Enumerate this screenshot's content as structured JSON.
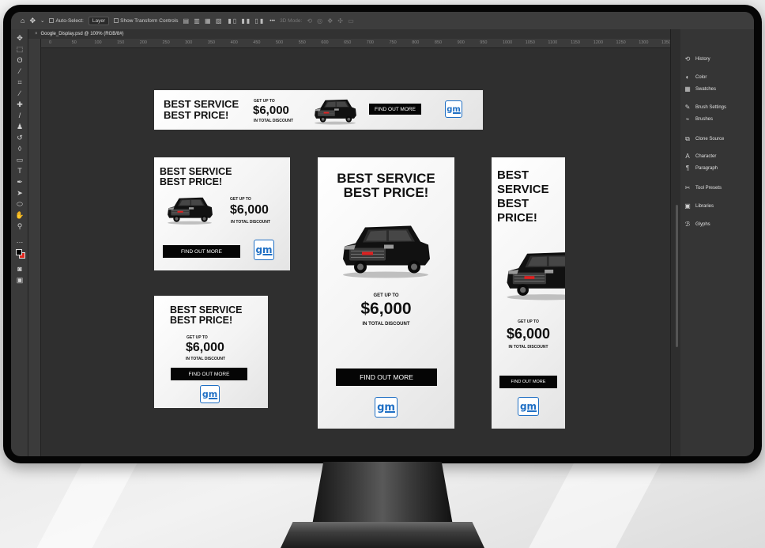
{
  "optionsbar": {
    "autoselect_label": "Auto-Select:",
    "autoselect_value": "Layer",
    "transform_label": "Show Transform Controls",
    "mode_label": "3D Mode:"
  },
  "document": {
    "tab_title": "Google_Display.psd @ 100% (RGB/8#)"
  },
  "ruler": [
    "0",
    "50",
    "100",
    "150",
    "200",
    "250",
    "300",
    "350",
    "400",
    "450",
    "500",
    "550",
    "600",
    "650",
    "700",
    "750",
    "800",
    "850",
    "900",
    "950",
    "1000",
    "1050",
    "1100",
    "1150",
    "1200",
    "1250",
    "1300",
    "1350"
  ],
  "panels": {
    "items": [
      {
        "label": "History",
        "icon": "history-icon"
      },
      {
        "label": "Color",
        "icon": "color-icon"
      },
      {
        "label": "Swatches",
        "icon": "swatches-icon"
      },
      {
        "label": "Brush Settings",
        "icon": "brush-settings-icon"
      },
      {
        "label": "Brushes",
        "icon": "brushes-icon"
      },
      {
        "label": "Clone Source",
        "icon": "clone-source-icon"
      },
      {
        "label": "Character",
        "icon": "character-icon"
      },
      {
        "label": "Paragraph",
        "icon": "paragraph-icon"
      },
      {
        "label": "Tool Presets",
        "icon": "tool-presets-icon"
      },
      {
        "label": "Libraries",
        "icon": "libraries-icon"
      },
      {
        "label": "Glyphs",
        "icon": "glyphs-icon"
      }
    ]
  },
  "ad": {
    "headline1": "BEST SERVICE",
    "headline2": "BEST PRICE!",
    "stacked": [
      "BEST",
      "SERVICE",
      "BEST",
      "PRICE!"
    ],
    "get_up_to": "GET UP TO",
    "amount": "$6,000",
    "discount": "IN TOTAL DISCOUNT",
    "cta": "FIND OUT MORE",
    "logo": "gm"
  },
  "colors": {
    "gm_blue": "#1f6fc4",
    "cta_black": "#050505",
    "background_swatch": "#e0281f"
  }
}
